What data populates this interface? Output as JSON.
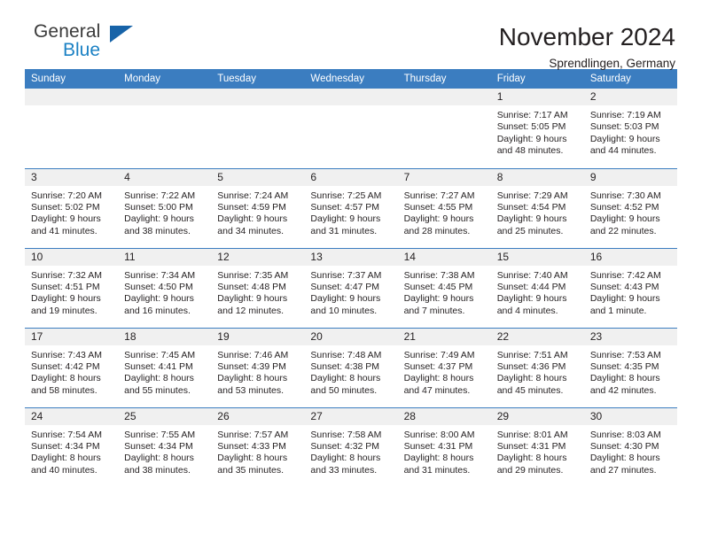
{
  "brand": {
    "line1": "General",
    "line2": "Blue",
    "mark": "triangle-logo"
  },
  "header": {
    "title": "November 2024",
    "subtitle": "Sprendlingen, Germany"
  },
  "colors": {
    "header_blue": "#3b7dc0",
    "brand_blue": "#1b81c4",
    "mark_blue": "#1763a8",
    "daynum_band": "#f0f0f0",
    "text": "#231f20"
  },
  "labels": {
    "sunrise": "Sunrise:",
    "sunset": "Sunset:",
    "daylight": "Daylight:"
  },
  "weekday_headers": [
    "Sunday",
    "Monday",
    "Tuesday",
    "Wednesday",
    "Thursday",
    "Friday",
    "Saturday"
  ],
  "weeks": [
    [
      {
        "day": ""
      },
      {
        "day": ""
      },
      {
        "day": ""
      },
      {
        "day": ""
      },
      {
        "day": ""
      },
      {
        "day": "1",
        "sunrise": "Sunrise: 7:17 AM",
        "sunset": "Sunset: 5:05 PM",
        "daylight": "Daylight: 9 hours and 48 minutes."
      },
      {
        "day": "2",
        "sunrise": "Sunrise: 7:19 AM",
        "sunset": "Sunset: 5:03 PM",
        "daylight": "Daylight: 9 hours and 44 minutes."
      }
    ],
    [
      {
        "day": "3",
        "sunrise": "Sunrise: 7:20 AM",
        "sunset": "Sunset: 5:02 PM",
        "daylight": "Daylight: 9 hours and 41 minutes."
      },
      {
        "day": "4",
        "sunrise": "Sunrise: 7:22 AM",
        "sunset": "Sunset: 5:00 PM",
        "daylight": "Daylight: 9 hours and 38 minutes."
      },
      {
        "day": "5",
        "sunrise": "Sunrise: 7:24 AM",
        "sunset": "Sunset: 4:59 PM",
        "daylight": "Daylight: 9 hours and 34 minutes."
      },
      {
        "day": "6",
        "sunrise": "Sunrise: 7:25 AM",
        "sunset": "Sunset: 4:57 PM",
        "daylight": "Daylight: 9 hours and 31 minutes."
      },
      {
        "day": "7",
        "sunrise": "Sunrise: 7:27 AM",
        "sunset": "Sunset: 4:55 PM",
        "daylight": "Daylight: 9 hours and 28 minutes."
      },
      {
        "day": "8",
        "sunrise": "Sunrise: 7:29 AM",
        "sunset": "Sunset: 4:54 PM",
        "daylight": "Daylight: 9 hours and 25 minutes."
      },
      {
        "day": "9",
        "sunrise": "Sunrise: 7:30 AM",
        "sunset": "Sunset: 4:52 PM",
        "daylight": "Daylight: 9 hours and 22 minutes."
      }
    ],
    [
      {
        "day": "10",
        "sunrise": "Sunrise: 7:32 AM",
        "sunset": "Sunset: 4:51 PM",
        "daylight": "Daylight: 9 hours and 19 minutes."
      },
      {
        "day": "11",
        "sunrise": "Sunrise: 7:34 AM",
        "sunset": "Sunset: 4:50 PM",
        "daylight": "Daylight: 9 hours and 16 minutes."
      },
      {
        "day": "12",
        "sunrise": "Sunrise: 7:35 AM",
        "sunset": "Sunset: 4:48 PM",
        "daylight": "Daylight: 9 hours and 12 minutes."
      },
      {
        "day": "13",
        "sunrise": "Sunrise: 7:37 AM",
        "sunset": "Sunset: 4:47 PM",
        "daylight": "Daylight: 9 hours and 10 minutes."
      },
      {
        "day": "14",
        "sunrise": "Sunrise: 7:38 AM",
        "sunset": "Sunset: 4:45 PM",
        "daylight": "Daylight: 9 hours and 7 minutes."
      },
      {
        "day": "15",
        "sunrise": "Sunrise: 7:40 AM",
        "sunset": "Sunset: 4:44 PM",
        "daylight": "Daylight: 9 hours and 4 minutes."
      },
      {
        "day": "16",
        "sunrise": "Sunrise: 7:42 AM",
        "sunset": "Sunset: 4:43 PM",
        "daylight": "Daylight: 9 hours and 1 minute."
      }
    ],
    [
      {
        "day": "17",
        "sunrise": "Sunrise: 7:43 AM",
        "sunset": "Sunset: 4:42 PM",
        "daylight": "Daylight: 8 hours and 58 minutes."
      },
      {
        "day": "18",
        "sunrise": "Sunrise: 7:45 AM",
        "sunset": "Sunset: 4:41 PM",
        "daylight": "Daylight: 8 hours and 55 minutes."
      },
      {
        "day": "19",
        "sunrise": "Sunrise: 7:46 AM",
        "sunset": "Sunset: 4:39 PM",
        "daylight": "Daylight: 8 hours and 53 minutes."
      },
      {
        "day": "20",
        "sunrise": "Sunrise: 7:48 AM",
        "sunset": "Sunset: 4:38 PM",
        "daylight": "Daylight: 8 hours and 50 minutes."
      },
      {
        "day": "21",
        "sunrise": "Sunrise: 7:49 AM",
        "sunset": "Sunset: 4:37 PM",
        "daylight": "Daylight: 8 hours and 47 minutes."
      },
      {
        "day": "22",
        "sunrise": "Sunrise: 7:51 AM",
        "sunset": "Sunset: 4:36 PM",
        "daylight": "Daylight: 8 hours and 45 minutes."
      },
      {
        "day": "23",
        "sunrise": "Sunrise: 7:53 AM",
        "sunset": "Sunset: 4:35 PM",
        "daylight": "Daylight: 8 hours and 42 minutes."
      }
    ],
    [
      {
        "day": "24",
        "sunrise": "Sunrise: 7:54 AM",
        "sunset": "Sunset: 4:34 PM",
        "daylight": "Daylight: 8 hours and 40 minutes."
      },
      {
        "day": "25",
        "sunrise": "Sunrise: 7:55 AM",
        "sunset": "Sunset: 4:34 PM",
        "daylight": "Daylight: 8 hours and 38 minutes."
      },
      {
        "day": "26",
        "sunrise": "Sunrise: 7:57 AM",
        "sunset": "Sunset: 4:33 PM",
        "daylight": "Daylight: 8 hours and 35 minutes."
      },
      {
        "day": "27",
        "sunrise": "Sunrise: 7:58 AM",
        "sunset": "Sunset: 4:32 PM",
        "daylight": "Daylight: 8 hours and 33 minutes."
      },
      {
        "day": "28",
        "sunrise": "Sunrise: 8:00 AM",
        "sunset": "Sunset: 4:31 PM",
        "daylight": "Daylight: 8 hours and 31 minutes."
      },
      {
        "day": "29",
        "sunrise": "Sunrise: 8:01 AM",
        "sunset": "Sunset: 4:31 PM",
        "daylight": "Daylight: 8 hours and 29 minutes."
      },
      {
        "day": "30",
        "sunrise": "Sunrise: 8:03 AM",
        "sunset": "Sunset: 4:30 PM",
        "daylight": "Daylight: 8 hours and 27 minutes."
      }
    ]
  ]
}
